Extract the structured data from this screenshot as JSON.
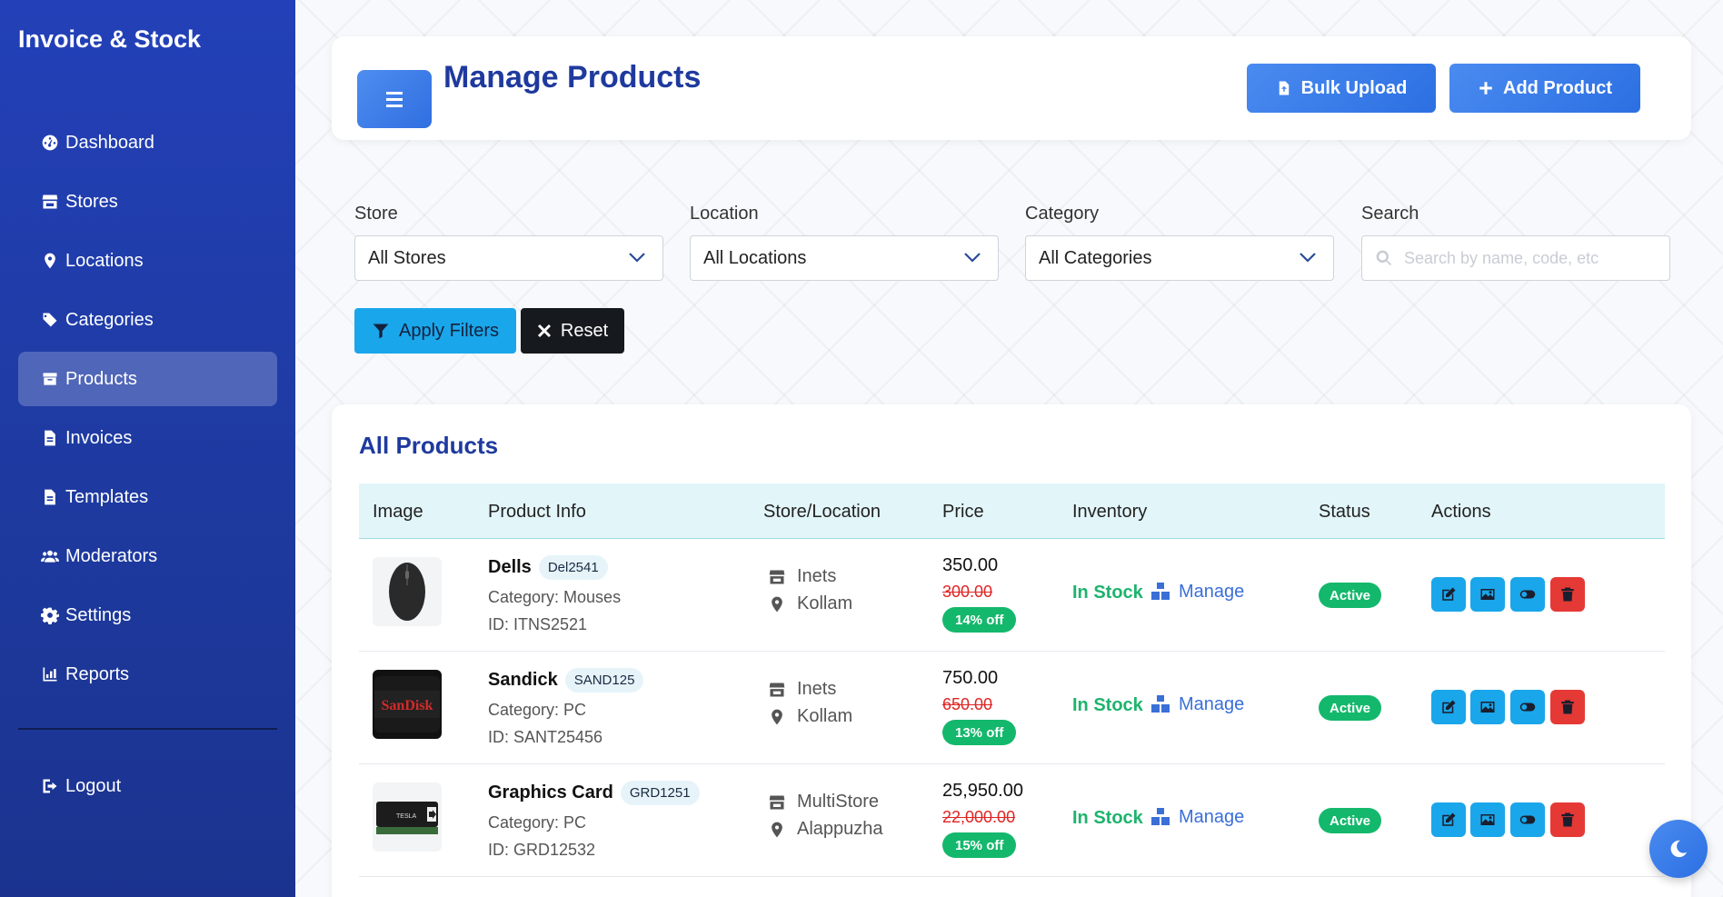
{
  "app": {
    "brand": "Invoice & Stock"
  },
  "sidebar": {
    "items": [
      {
        "label": "Dashboard",
        "icon": "dashboard-icon"
      },
      {
        "label": "Stores",
        "icon": "store-icon"
      },
      {
        "label": "Locations",
        "icon": "map-pin-icon"
      },
      {
        "label": "Categories",
        "icon": "tags-icon"
      },
      {
        "label": "Products",
        "icon": "box-icon",
        "active": true
      },
      {
        "label": "Invoices",
        "icon": "file-icon"
      },
      {
        "label": "Templates",
        "icon": "file-icon"
      },
      {
        "label": "Moderators",
        "icon": "users-icon"
      },
      {
        "label": "Settings",
        "icon": "gear-icon"
      },
      {
        "label": "Reports",
        "icon": "chart-icon"
      }
    ],
    "logout": "Logout"
  },
  "header": {
    "title": "Manage Products",
    "bulk_upload": "Bulk Upload",
    "add_product": "Add Product"
  },
  "filters": {
    "store_label": "Store",
    "store_value": "All Stores",
    "location_label": "Location",
    "location_value": "All Locations",
    "category_label": "Category",
    "category_value": "All Categories",
    "search_label": "Search",
    "search_placeholder": "Search by name, code, etc",
    "apply": "Apply Filters",
    "reset": "Reset"
  },
  "products": {
    "title": "All Products",
    "columns": [
      "Image",
      "Product Info",
      "Store/Location",
      "Price",
      "Inventory",
      "Status",
      "Actions"
    ],
    "rows": [
      {
        "name": "Dells",
        "code": "Del2541",
        "category": "Category: Mouses",
        "id": "ID: ITNS2521",
        "store": "Inets",
        "location": "Kollam",
        "price": "350.00",
        "old_price": "300.00",
        "discount": "14% off",
        "stock": "In Stock",
        "manage": "Manage",
        "status": "Active",
        "image": "mouse"
      },
      {
        "name": "Sandick",
        "code": "SAND125",
        "category": "Category: PC",
        "id": "ID: SANT25456",
        "store": "Inets",
        "location": "Kollam",
        "price": "750.00",
        "old_price": "650.00",
        "discount": "13% off",
        "stock": "In Stock",
        "manage": "Manage",
        "status": "Active",
        "image": "sandisk",
        "image_text": "SanDisk"
      },
      {
        "name": "Graphics Card",
        "code": "GRD1251",
        "category": "Category: PC",
        "id": "ID: GRD12532",
        "store": "MultiStore",
        "location": "Alappuzha",
        "price": "25,950.00",
        "old_price": "22,000.00",
        "discount": "15% off",
        "stock": "In Stock",
        "manage": "Manage",
        "status": "Active",
        "image": "gpu",
        "image_text": "TESLA"
      }
    ]
  },
  "colors": {
    "sidebar": "#2340b8",
    "accent": "#2f6fe0",
    "title": "#1f3a9e",
    "success": "#14b86c",
    "danger": "#e53935",
    "info": "#1aa6ea"
  }
}
